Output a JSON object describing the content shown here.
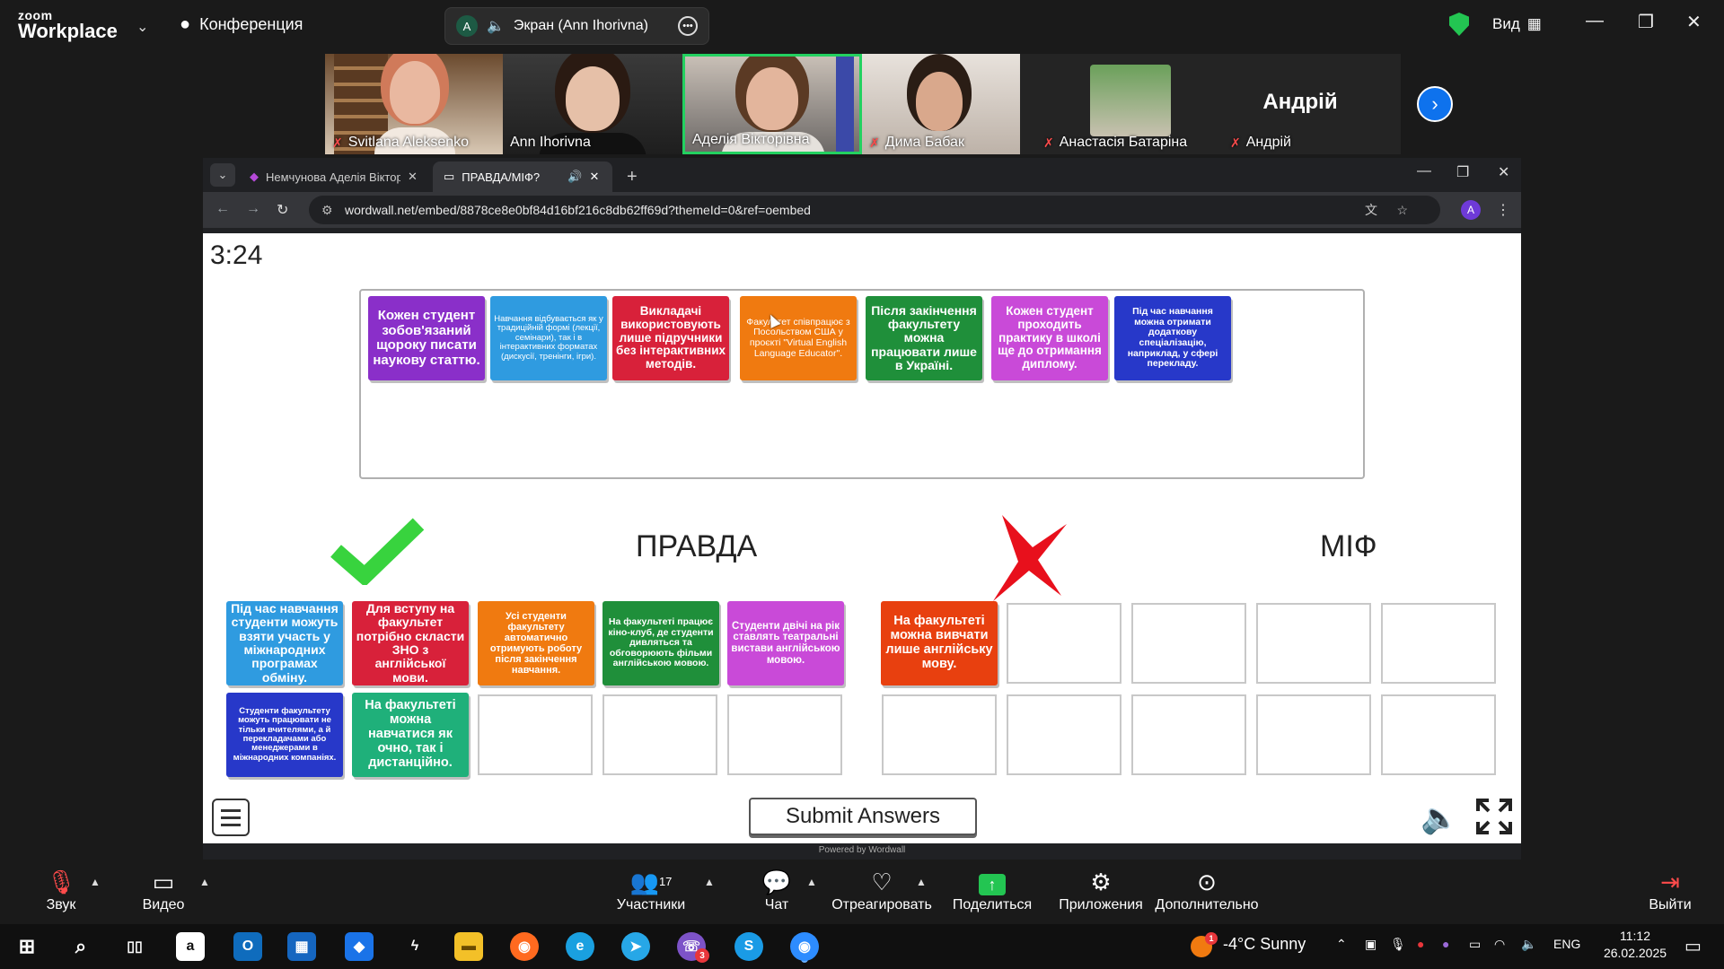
{
  "zoom": {
    "logo_small": "zoom",
    "logo_big": "Workplace",
    "conference_label": "Конференция",
    "share_avatar_letter": "A",
    "share_label": "Экран (Ann Ihorivna)",
    "view_label": "Вид",
    "participants": [
      {
        "name": "Svitlana Aleksenko",
        "muted": true
      },
      {
        "name": "Ann Ihorivna",
        "muted": false
      },
      {
        "name": "Аделія Вікторівна",
        "muted": false
      },
      {
        "name": "Дима Бабак",
        "muted": true
      },
      {
        "name": "Анастасія Батаріна",
        "muted": true
      },
      {
        "name": "Андрій",
        "muted": true
      }
    ],
    "andrii_big_name": "Андрій",
    "toolbar": {
      "audio": "Звук",
      "video": "Видео",
      "participants": "Участники",
      "participants_count": "17",
      "chat": "Чат",
      "react": "Отреагировать",
      "share": "Поделиться",
      "apps": "Приложения",
      "more": "Дополнительно",
      "leave": "Выйти"
    }
  },
  "browser": {
    "tab1_title": "Немчунова Аделія Вікторівна",
    "tab2_title": "ПРАВДА/МІФ?",
    "url": "wordwall.net/embed/8878ce8e0bf84d16bf216c8db62ff69d?themeId=0&ref=oembed",
    "profile_letter": "A"
  },
  "game": {
    "timer": "3:24",
    "heading_true": "ПРАВДА",
    "heading_false": "МІФ",
    "submit_label": "Submit Answers",
    "powered_by": "Powered by Wordwall",
    "pool_cards": [
      {
        "text": "Кожен студент зобов'язаний щороку писати наукову статтю.",
        "color": "#8a2fc9"
      },
      {
        "text": "Навчання відбувається як у традиційній формі (лекції, семінари), так і в інтерактивних форматах (дискусії, тренінги, ігри).",
        "color": "#2f9be0"
      },
      {
        "text": "Викладачі використовують лише підручники без інтерактивних методів.",
        "color": "#d8213a"
      },
      {
        "text": "Факультет співпрацює з Посольством США у проєкті \"Virtual English Language Educator\".",
        "color": "#f07a10"
      },
      {
        "text": "Після закінчення факультету можна працювати лише в Україні.",
        "color": "#1f8f3a"
      },
      {
        "text": "Кожен студент проходить практику в школі ще до отримання диплому.",
        "color": "#c94ad8"
      },
      {
        "text": "Під час навчання можна отримати додаткову спеціалізацію, наприклад, у сфері перекладу.",
        "color": "#2738c9"
      }
    ],
    "true_cards": [
      {
        "text": "Під час навчання студенти можуть взяти участь у міжнародних програмах обміну.",
        "color": "#2f9be0"
      },
      {
        "text": "Для вступу на факультет потрібно скласти ЗНО з англійської мови.",
        "color": "#d8213a"
      },
      {
        "text": "Усі студенти факультету автоматично отримують роботу після закінчення навчання.",
        "color": "#f07a10"
      },
      {
        "text": "На факультеті працює кіно-клуб, де студенти дивляться та обговорюють фільми англійською мовою.",
        "color": "#1f8f3a"
      },
      {
        "text": "Студенти двічі на рік ставлять театральні вистави англійською мовою.",
        "color": "#c94ad8"
      },
      {
        "text": "Студенти факультету можуть працювати не тільки вчителями, а й перекладачами або менеджерами в міжнародних компаніях.",
        "color": "#2738c9"
      },
      {
        "text": "На факультеті можна навчатися як очно, так і дистанційно.",
        "color": "#1fb07a"
      }
    ],
    "false_cards": [
      {
        "text": "На факультеті можна вивчати лише англійську мову.",
        "color": "#e8400f"
      }
    ]
  },
  "taskbar": {
    "weather_temp": "-4°C",
    "weather_desc": "Sunny",
    "lang": "ENG",
    "time": "11:12",
    "date": "26.02.2025",
    "viber_badge": "3",
    "weather_badge": "1"
  }
}
